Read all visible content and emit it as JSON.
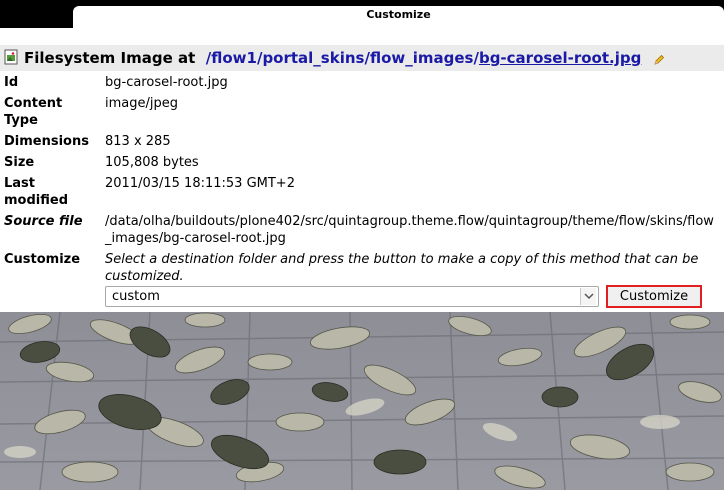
{
  "tab": {
    "title": "Customize"
  },
  "heading": {
    "prefix": "Filesystem Image at",
    "path": [
      "/flow1",
      "portal_skins",
      "flow_images",
      "bg-carosel-root.jpg"
    ],
    "sep": "/"
  },
  "props": {
    "id": {
      "label": "Id",
      "value": "bg-carosel-root.jpg"
    },
    "content_type": {
      "label": "Content Type",
      "value": "image/jpeg"
    },
    "dimensions": {
      "label": "Dimensions",
      "value": "813 x 285"
    },
    "size": {
      "label": "Size",
      "value": "105,808 bytes"
    },
    "last_modified": {
      "label": "Last modified",
      "value": "2011/03/15 18:11:53 GMT+2"
    },
    "source_file": {
      "label": "Source file",
      "value": "/data/olha/buildouts/plone402/src/quintagroup.theme.flow/quintagroup/theme/flow/skins/flow_images/bg-carosel-root.jpg"
    },
    "customize": {
      "label": "Customize",
      "hint": "Select a destination folder and press the button to make a copy of this method that can be customized."
    }
  },
  "folder_select": {
    "selected": "custom"
  },
  "customize_button": {
    "label": "Customize"
  },
  "icons": {
    "file": "image-file-icon",
    "edit": "pencil-icon",
    "dropdown": "chevron-down-icon"
  }
}
